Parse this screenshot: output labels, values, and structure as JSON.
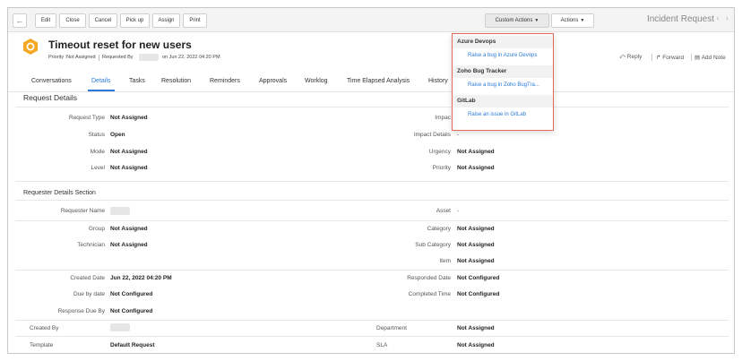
{
  "toolbar": {
    "back": "←",
    "edit": "Edit",
    "close": "Close",
    "cancel": "Cancel",
    "pickup": "Pick up",
    "assign": "Assign",
    "print": "Print",
    "custom_actions": "Custom Actions",
    "actions": "Actions",
    "window_title": "Incident Request",
    "nav": "‹ ›"
  },
  "header": {
    "title": "Timeout reset for new users",
    "priority": "Priority :Not Assigned",
    "requested_by": "Requested By",
    "date": "on Jun 22, 2022 04:20 PM",
    "reply": "Reply",
    "forward": "Forward",
    "add_note": "Add Note"
  },
  "tabs": [
    "Conversations",
    "Details",
    "Tasks",
    "Resolution",
    "Reminders",
    "Approvals",
    "Worklog",
    "Time Elapsed Analysis",
    "History"
  ],
  "request_details": {
    "heading": "Request Details",
    "request_type_label": "Request Type",
    "request_type": "Not Assigned",
    "status_label": "Status",
    "status": "Open",
    "mode_label": "Mode",
    "mode": "Not Assigned",
    "level_label": "Level",
    "level": "Not Assigned",
    "impact_label": "Impac",
    "impact_details_label": "Impact Details",
    "impact_details": "-",
    "urgency_label": "Urgency",
    "urgency": "Not Assigned",
    "priority_label": "Priority",
    "priority": "Not Assigned"
  },
  "requester_details": {
    "heading": "Requester Details Section",
    "requester_name_label": "Requester Name",
    "asset_label": "Asset",
    "asset": "-",
    "group_label": "Group",
    "group": "Not Assigned",
    "category_label": "Category",
    "category": "Not Assigned",
    "technician_label": "Technician",
    "technician": "Not Assigned",
    "subcategory_label": "Sub Category",
    "subcategory": "Not Assigned",
    "item_label": "Item",
    "item": "Not Assigned",
    "created_date_label": "Created Date",
    "created_date": "Jun 22, 2022 04:20 PM",
    "responded_date_label": "Responded Date",
    "responded_date": "Not Configured",
    "due_by_label": "Due by date",
    "due_by": "Not Configured",
    "completed_time_label": "Completed Time",
    "completed_time": "Not Configured",
    "response_due_label": "Response Due By",
    "response_due": "Not Configured",
    "created_by_label": "Created By",
    "department_label": "Department",
    "department": "Not Assigned",
    "template_label": "Template",
    "template": "Default Request",
    "sla_label": "SLA",
    "sla": "Not Assigned"
  },
  "custom_actions_menu": {
    "azure_heading": "Azure Devops",
    "azure_item": "Raise a bug in Azure Devops",
    "zoho_heading": "Zoho Bug Tracker",
    "zoho_item": "Raise a bug in Zoho BugTra...",
    "gitlab_heading": "GitLab",
    "gitlab_item": "Raise an issue in GitLab"
  },
  "colors": {
    "accent": "#2a7ad8",
    "logo": "#f5a623",
    "dropdown_border": "#e46b5b"
  }
}
